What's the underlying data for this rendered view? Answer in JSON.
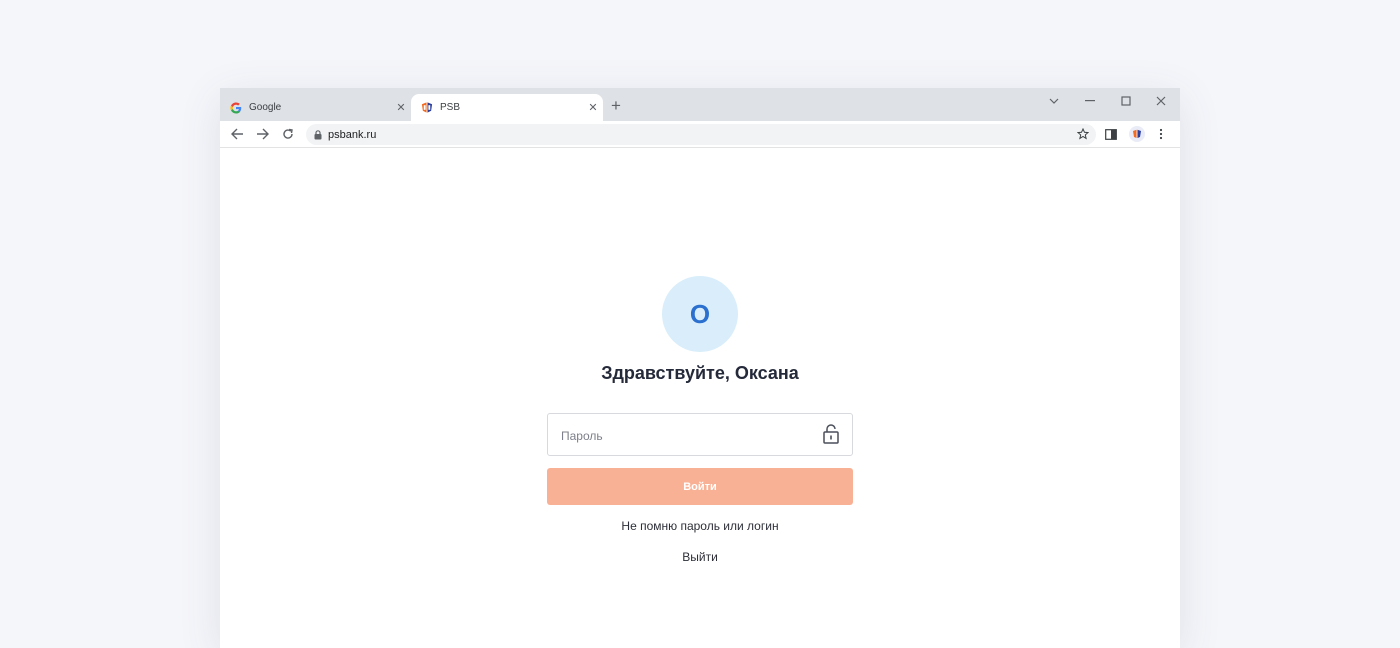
{
  "browser": {
    "tabs": [
      {
        "title": "Google",
        "favicon": "google-g-icon",
        "active": false
      },
      {
        "title": "PSB",
        "favicon": "psb-logo-icon",
        "active": true
      }
    ],
    "new_tab": "+",
    "url": "psbank.ru"
  },
  "page": {
    "avatar_initial": "О",
    "greeting": "Здравствуйте, Оксана",
    "password_placeholder": "Пароль",
    "login_button": "Войти",
    "forgot_link": "Не помню пароль или логин",
    "logout_link": "Выйти"
  },
  "colors": {
    "accent_button": "#f9b196",
    "avatar_bg": "#d9eefa",
    "avatar_text": "#2b6fcf"
  }
}
